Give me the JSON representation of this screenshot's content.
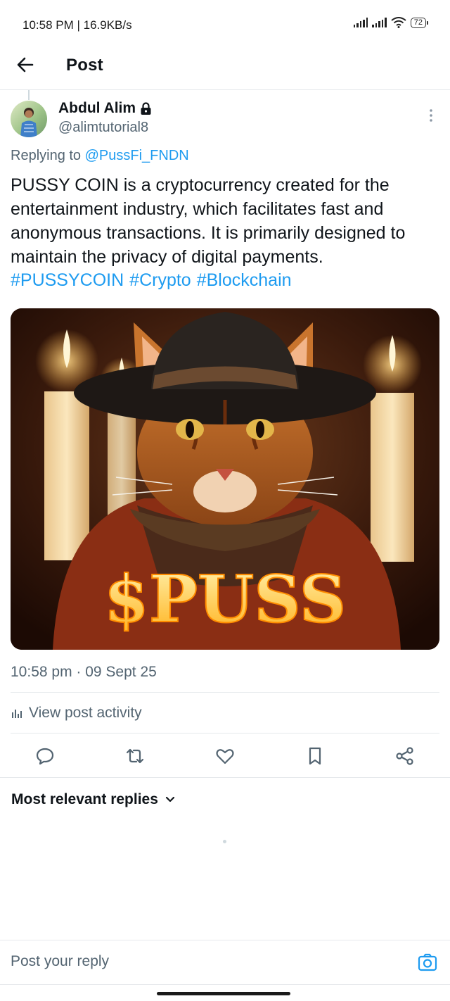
{
  "status_bar": {
    "time": "10:58 PM | 16.9KB/s",
    "battery": "72"
  },
  "header": {
    "title": "Post"
  },
  "post": {
    "author_name": "Abdul Alim",
    "author_handle": "@alimtutorial8",
    "replying_prefix": "Replying to ",
    "replying_to": "@PussFi_FNDN",
    "text": "PUSSY COIN is a cryptocurrency created for the entertainment industry, which facilitates fast and anonymous transactions. It is primarily designed to maintain the privacy of digital payments.",
    "hashtags": [
      "#PUSSYCOIN",
      "#Crypto",
      "#Blockchain"
    ],
    "image_caption": "$PUSS",
    "timestamp": "10:58 pm · 09 Sept 25",
    "activity_label": "View post activity"
  },
  "actions": {
    "icons": [
      "reply-icon",
      "repost-icon",
      "like-icon",
      "bookmark-icon",
      "share-icon"
    ]
  },
  "replies": {
    "sort_label": "Most relevant replies"
  },
  "reply_bar": {
    "placeholder": "Post your reply"
  },
  "colors": {
    "accent": "#1d9bf0",
    "secondary_text": "#536471",
    "primary_text": "#0f1419",
    "divider": "#e6e9ec"
  }
}
